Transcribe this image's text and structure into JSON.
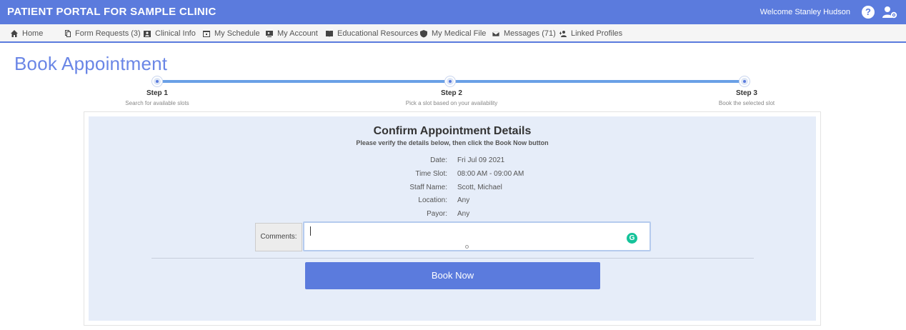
{
  "app": {
    "title": "PATIENT PORTAL FOR SAMPLE CLINIC",
    "welcome": "Welcome Stanley Hudson",
    "help_glyph": "?",
    "accent_color": "#5b7bdd"
  },
  "nav": {
    "items": [
      {
        "label": "Home",
        "icon": "home-icon"
      },
      {
        "label": "Form Requests (3)",
        "icon": "forms-icon"
      },
      {
        "label": "Clinical Info",
        "icon": "clinical-icon"
      },
      {
        "label": "My Schedule",
        "icon": "calendar-icon"
      },
      {
        "label": "My Account",
        "icon": "account-icon"
      },
      {
        "label": "Educational Resources",
        "icon": "book-icon"
      },
      {
        "label": "My Medical File",
        "icon": "shield-icon"
      },
      {
        "label": "Messages (71)",
        "icon": "envelope-icon"
      },
      {
        "label": "Linked Profiles",
        "icon": "linked-profiles-icon"
      }
    ]
  },
  "page": {
    "title": "Book Appointment"
  },
  "steps": [
    {
      "label": "Step 1",
      "sub": "Search for available slots"
    },
    {
      "label": "Step 2",
      "sub": "Pick a slot based on your availability"
    },
    {
      "label": "Step 3",
      "sub": "Book the selected slot"
    }
  ],
  "confirm": {
    "title": "Confirm Appointment Details",
    "subtitle": "Please verify the details below, then click the Book Now button",
    "details": [
      {
        "key": "Date:",
        "value": "Fri Jul 09 2021"
      },
      {
        "key": "Time Slot:",
        "value": "08:00 AM - 09:00 AM"
      },
      {
        "key": "Staff Name:",
        "value": "Scott, Michael"
      },
      {
        "key": "Location:",
        "value": "Any"
      },
      {
        "key": "Payor:",
        "value": "Any"
      }
    ],
    "comments_label": "Comments:",
    "comments_value": "",
    "grammarly_glyph": "G",
    "book_button": "Book Now"
  }
}
